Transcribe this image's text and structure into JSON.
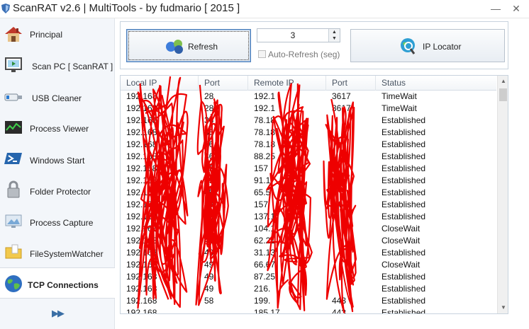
{
  "window": {
    "title": "ScanRAT v2.6 | MultiTools - by fudmario [ 2015 ]",
    "minimize": "—",
    "close": "✕"
  },
  "sidebar": {
    "items": [
      {
        "label": "Principal",
        "icon": "house-icon"
      },
      {
        "label": "Scan PC [ ScanRAT ]",
        "icon": "scan-monitor-icon"
      },
      {
        "label": "USB Cleaner",
        "icon": "usb-drive-icon"
      },
      {
        "label": "Process Viewer",
        "icon": "process-monitor-icon"
      },
      {
        "label": "Windows Start",
        "icon": "powershell-icon"
      },
      {
        "label": "Folder Protector",
        "icon": "padlock-icon"
      },
      {
        "label": "Process Capture",
        "icon": "screen-capture-icon"
      },
      {
        "label": "FileSystemWatcher",
        "icon": "folder-watch-icon"
      },
      {
        "label": "TCP Connections",
        "icon": "globe-icon",
        "active": true
      }
    ],
    "expand_label": "▶▶"
  },
  "toolbar": {
    "refresh_label": "Refresh",
    "interval_value": "3",
    "auto_refresh_label": "Auto-Refresh (seg)",
    "auto_refresh_checked": false,
    "ip_locator_label": "IP Locator"
  },
  "table": {
    "columns": [
      "Local IP",
      "Port",
      "Remote IP",
      "Port",
      "Status"
    ],
    "rows": [
      [
        "192.168",
        "28",
        "192.1",
        "3617",
        "TimeWait"
      ],
      [
        "192.168",
        "28",
        "192.1",
        "3617",
        "TimeWait"
      ],
      [
        "192.168",
        "36",
        "78.18",
        "",
        "Established"
      ],
      [
        "192.168",
        "36",
        "78.18",
        "",
        "Established"
      ],
      [
        "192.168",
        "36",
        "78.18",
        "",
        "Established"
      ],
      [
        "192.168",
        "36",
        "88.25",
        "",
        "Established"
      ],
      [
        "192.168",
        "49",
        "157",
        "",
        "Established"
      ],
      [
        "192.168",
        "49",
        "91.1",
        "",
        "Established"
      ],
      [
        "192.168",
        "49",
        "65.5",
        "",
        "Established"
      ],
      [
        "192.168",
        "49",
        "157",
        "44",
        "Established"
      ],
      [
        "192.168",
        "49",
        "137.1",
        "",
        "Established"
      ],
      [
        "192.168",
        "49",
        "104.1",
        "",
        "CloseWait"
      ],
      [
        "192.168",
        "49",
        "62.21",
        "",
        "CloseWait"
      ],
      [
        "192.168",
        "49",
        "31.13",
        "",
        "Established"
      ],
      [
        "192.168",
        "49",
        "66.67",
        "",
        "CloseWait"
      ],
      [
        "192.168",
        "49",
        "87.25",
        "",
        "Established"
      ],
      [
        "192.168",
        "49",
        "216.",
        "",
        "Established"
      ],
      [
        "192.168",
        "58",
        "199.",
        "443",
        "Established"
      ],
      [
        "192.168",
        "",
        "185.17",
        "443",
        "Established"
      ]
    ]
  }
}
